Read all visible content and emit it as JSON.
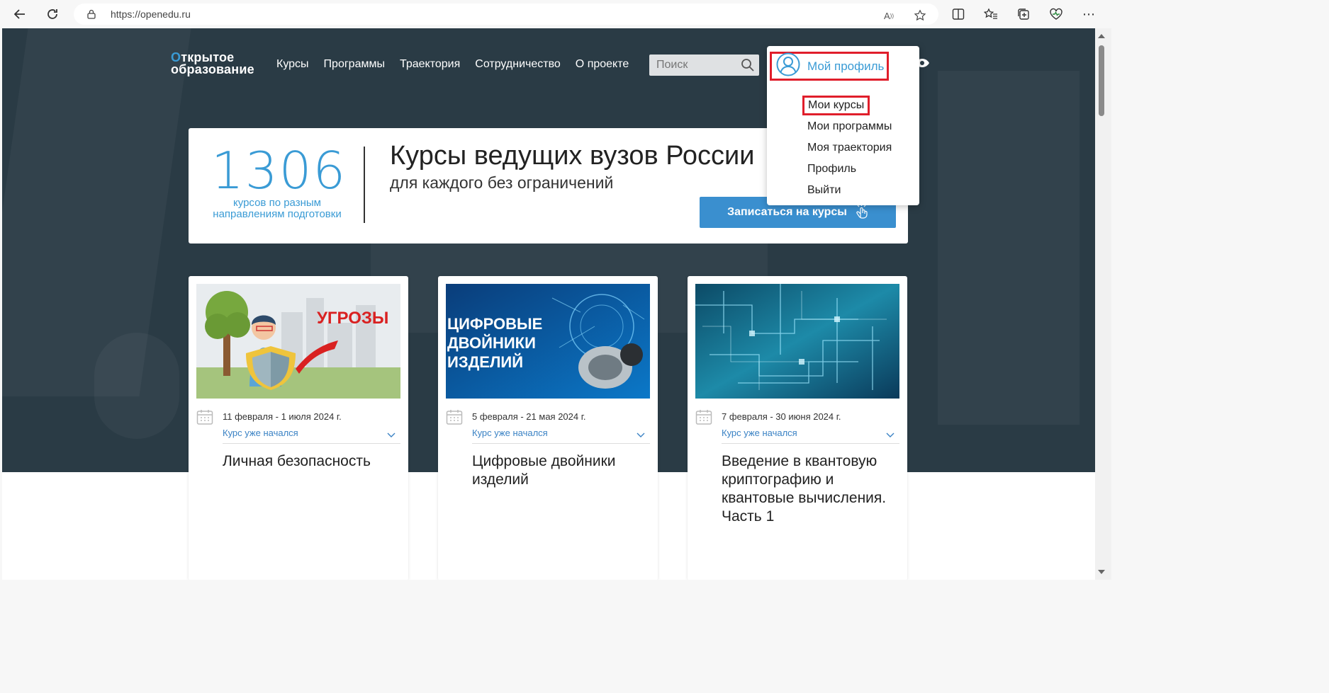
{
  "browser": {
    "url": "https://openedu.ru",
    "icons": [
      "back-arrow-icon",
      "refresh-icon",
      "lock-icon",
      "read-aloud-icon",
      "favorite-star-icon",
      "split-screen-icon",
      "favorites-icon",
      "collections-icon",
      "browser-essentials-icon",
      "more-icon"
    ]
  },
  "site": {
    "logo_line1": "ткрытое",
    "logo_letter": "О",
    "logo_line2": "образование",
    "menu": [
      "Курсы",
      "Программы",
      "Траектория",
      "Сотрудничество",
      "О проекте"
    ],
    "search_placeholder": "Поиск"
  },
  "banner": {
    "count": "1306",
    "count_label": "курсов по разным направлениям подготовки",
    "title": "Курсы ведущих вузов России",
    "subtitle": "для каждого без ограничений",
    "cta": "Записаться на курсы"
  },
  "profile_menu": {
    "profile_label": "Мой профиль",
    "items": [
      "Мои курсы",
      "Мои программы",
      "Моя траектория",
      "Профиль",
      "Выйти"
    ]
  },
  "courses": [
    {
      "dates": "11 февраля - 1 июля 2024 г.",
      "status": "Курс уже начался",
      "title": "Личная безопасность",
      "image_text": "УГРОЗЫ"
    },
    {
      "dates": "5 февраля - 21 мая 2024 г.",
      "status": "Курс уже начался",
      "title": "Цифровые двойники изделий",
      "image_text": "ЦИФРОВЫЕ ДВОЙНИКИ ИЗДЕЛИЙ"
    },
    {
      "dates": "7 февраля - 30 июня 2024 г.",
      "status": "Курс уже начался",
      "title": "Введение в квантовую криптографию и квантовые вычисления. Часть 1",
      "image_text": ""
    }
  ],
  "colors": {
    "accent": "#3a9bd5",
    "hero_bg": "#2a3b45",
    "highlight": "#e01e2b",
    "button": "#3a8fcf"
  }
}
